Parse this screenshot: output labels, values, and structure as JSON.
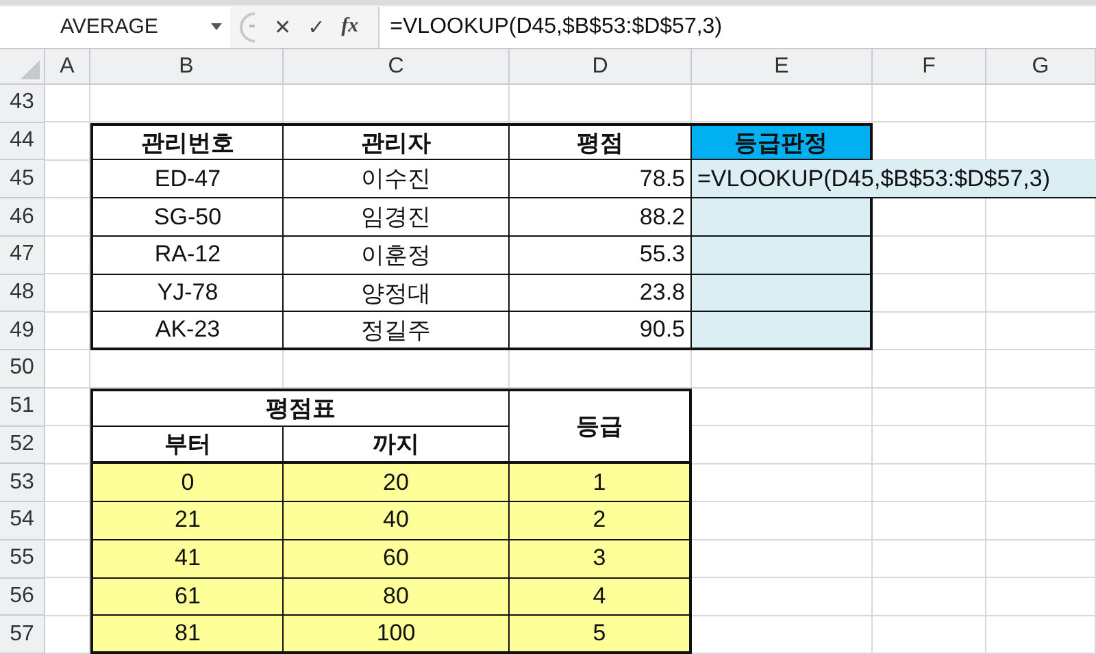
{
  "formula_bar": {
    "name_box": "AVERAGE",
    "cancel_icon": "✕",
    "enter_icon": "✓",
    "function_icon": "fx",
    "formula": "=VLOOKUP(D45,$B$53:$D$57,3)"
  },
  "columns": [
    "A",
    "B",
    "C",
    "D",
    "E",
    "F",
    "G"
  ],
  "rows": [
    "43",
    "44",
    "45",
    "46",
    "47",
    "48",
    "49",
    "50",
    "51",
    "52",
    "53",
    "54",
    "55",
    "56",
    "57"
  ],
  "score_table": {
    "headers": [
      "관리번호",
      "관리자",
      "평점",
      "등급판정"
    ],
    "rows": [
      {
        "code": "ED-47",
        "manager": "이수진",
        "score": "78.5",
        "grade": "=VLOOKUP(D45,$B$53:$D$57,3)"
      },
      {
        "code": "SG-50",
        "manager": "임경진",
        "score": "88.2"
      },
      {
        "code": "RA-12",
        "manager": "이훈정",
        "score": "55.3"
      },
      {
        "code": "YJ-78",
        "manager": "양정대",
        "score": "23.8"
      },
      {
        "code": "AK-23",
        "manager": "정길주",
        "score": "90.5"
      }
    ]
  },
  "grade_table": {
    "title": "평점표",
    "from_header": "부터",
    "to_header": "까지",
    "grade_header": "등급",
    "rows": [
      {
        "from": "0",
        "to": "20",
        "grade": "1"
      },
      {
        "from": "21",
        "to": "40",
        "grade": "2"
      },
      {
        "from": "41",
        "to": "60",
        "grade": "3"
      },
      {
        "from": "61",
        "to": "80",
        "grade": "4"
      },
      {
        "from": "81",
        "to": "100",
        "grade": "5"
      }
    ]
  }
}
